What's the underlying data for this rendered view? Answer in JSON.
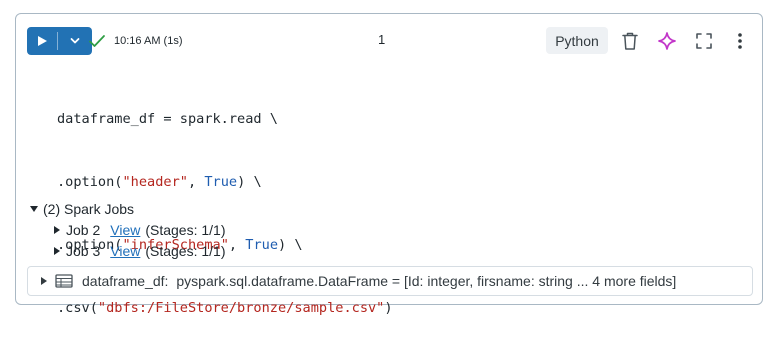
{
  "toolbar": {
    "run_time": "10:16 AM (1s)",
    "cell_index": "1",
    "language": "Python",
    "icons": [
      "play-icon",
      "chevron-down-icon",
      "check-icon",
      "trash-icon",
      "sparkle-icon",
      "expand-icon",
      "more-vertical-icon"
    ],
    "accent_color": "#2272b4",
    "success_color": "#2f9e44",
    "assistant_color": "#c236c9"
  },
  "code": {
    "line1": "dataframe_df = spark.read \\",
    "line2_pre": ".option(",
    "line2_str": "\"header\"",
    "line2_mid": ", ",
    "line2_kw": "True",
    "line2_post": ") \\",
    "line3_pre": ".option(",
    "line3_str": "\"inferSchema\"",
    "line3_mid": ", ",
    "line3_kw": "True",
    "line3_post": ") \\",
    "line4_pre": ".csv(",
    "line4_str": "\"dbfs:/FileStore/bronze/sample.csv\"",
    "line4_post": ")"
  },
  "jobs": {
    "summary": "(2) Spark Jobs",
    "items": [
      {
        "name": "Job 2",
        "link": "View",
        "stages": "(Stages: 1/1)"
      },
      {
        "name": "Job 3",
        "link": "View",
        "stages": "(Stages: 1/1)"
      }
    ]
  },
  "schema": {
    "name": "dataframe_df:",
    "type": "pyspark.sql.dataframe.DataFrame = [Id: integer, firsname: string ... 4 more fields]"
  }
}
